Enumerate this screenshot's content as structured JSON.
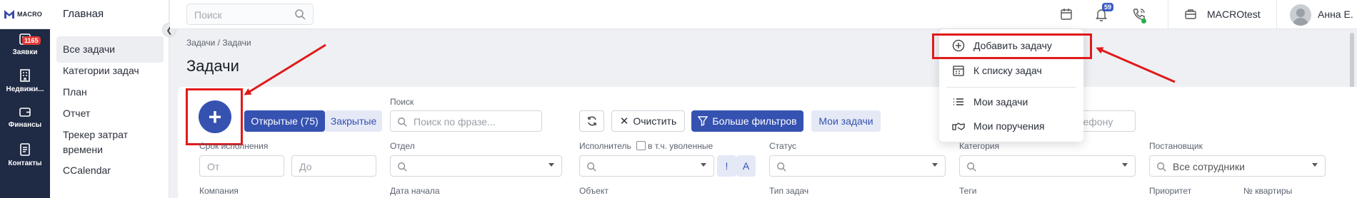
{
  "brand": {
    "name": "MACRO"
  },
  "rail": {
    "items": [
      {
        "label": "Заявки",
        "badge": "1165"
      },
      {
        "label": "Недвижи..."
      },
      {
        "label": "Финансы"
      },
      {
        "label": "Контакты"
      }
    ]
  },
  "subnav": {
    "title": "Главная",
    "items": [
      {
        "label": "Все задачи"
      },
      {
        "label": "Категории задач"
      },
      {
        "label": "План"
      },
      {
        "label": "Отчет"
      },
      {
        "label": "Трекер затрат времени"
      },
      {
        "label": "CCalendar"
      }
    ]
  },
  "topbar": {
    "search_placeholder": "Поиск",
    "notifications_count": "59",
    "company": "MACROtest",
    "user": "Анна Е."
  },
  "breadcrumb": {
    "root": "Задачи",
    "sep": "/",
    "current": "Задачи"
  },
  "page": {
    "title": "Задачи"
  },
  "toolbar": {
    "add_symbol": "+",
    "tab_open": "Открытые (75)",
    "tab_closed": "Закрытые",
    "search_label": "Поиск",
    "search_placeholder": "Поиск по фразе...",
    "clear_label": "Очистить",
    "more_filters_label": "Больше фильтров",
    "my_tasks_label": "Мои задачи",
    "phone_partial": "елефону"
  },
  "filters": {
    "deadline_label": "Срок исполнения",
    "from_placeholder": "От",
    "to_placeholder": "До",
    "department_label": "Отдел",
    "executor_label": "Исполнитель",
    "include_fired_label": "в т.ч. уволенные",
    "excl_btn": "!",
    "a_btn": "А",
    "status_label": "Статус",
    "category_label": "Категория",
    "author_label": "Постановщик",
    "author_value": "Все сотрудники",
    "company_label": "Компания",
    "start_date_label": "Дата начала",
    "object_label": "Объект",
    "task_type_label": "Тип задач",
    "tags_label": "Теги",
    "priority_label": "Приоритет",
    "apartments_label": "№ квартиры"
  },
  "dropdown": {
    "items": [
      {
        "label": "Добавить задачу",
        "icon": "plus-circle-icon"
      },
      {
        "label": "К списку задач",
        "icon": "calendar-list-icon"
      },
      {
        "label": "Мои задачи",
        "icon": "list-icon"
      },
      {
        "label": "Мои поручения",
        "icon": "handshake-icon"
      }
    ]
  },
  "colors": {
    "accent": "#3552b1",
    "rail": "#1f2a44",
    "annotation": "#e01a1a",
    "badge": "#e53935",
    "online": "#22b14c"
  }
}
